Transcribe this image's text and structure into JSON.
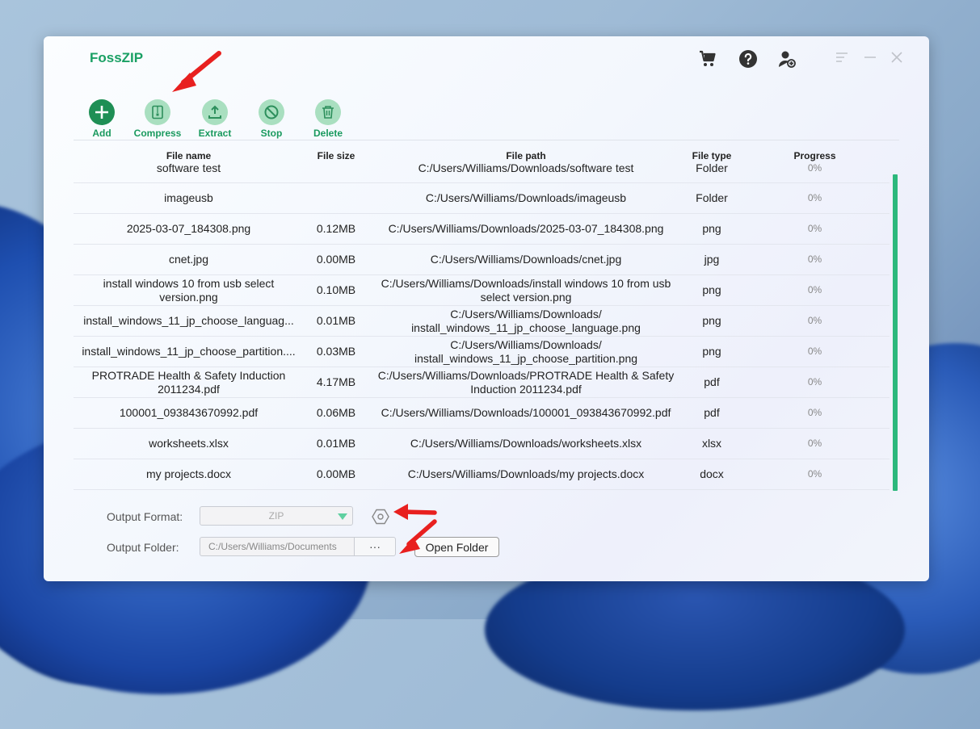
{
  "app": {
    "title": "FossZIP"
  },
  "toolbar": {
    "add": "Add",
    "compress": "Compress",
    "extract": "Extract",
    "stop": "Stop",
    "delete": "Delete"
  },
  "table": {
    "headers": [
      "File name",
      "File size",
      "File path",
      "File type",
      "Progress"
    ],
    "rows": [
      {
        "name": "software test",
        "size": "",
        "path": "C:/Users/Williams/Downloads/software test",
        "type": "Folder",
        "progress": "0%"
      },
      {
        "name": "imageusb",
        "size": "",
        "path": "C:/Users/Williams/Downloads/imageusb",
        "type": "Folder",
        "progress": "0%"
      },
      {
        "name": "2025-03-07_184308.png",
        "size": "0.12MB",
        "path": "C:/Users/Williams/Downloads/2025-03-07_184308.png",
        "type": "png",
        "progress": "0%"
      },
      {
        "name": "cnet.jpg",
        "size": "0.00MB",
        "path": "C:/Users/Williams/Downloads/cnet.jpg",
        "type": "jpg",
        "progress": "0%"
      },
      {
        "name": "install windows 10 from usb select version.png",
        "size": "0.10MB",
        "path": "C:/Users/Williams/Downloads/install windows 10 from usb select version.png",
        "type": "png",
        "progress": "0%"
      },
      {
        "name": "install_windows_11_jp_choose_languag...",
        "size": "0.01MB",
        "path": "C:/Users/Williams/Downloads/ install_windows_11_jp_choose_language.png",
        "type": "png",
        "progress": "0%"
      },
      {
        "name": "install_windows_11_jp_choose_partition....",
        "size": "0.03MB",
        "path": "C:/Users/Williams/Downloads/ install_windows_11_jp_choose_partition.png",
        "type": "png",
        "progress": "0%"
      },
      {
        "name": "PROTRADE Health & Safety Induction 2011234.pdf",
        "size": "4.17MB",
        "path": "C:/Users/Williams/Downloads/PROTRADE Health & Safety Induction 2011234.pdf",
        "type": "pdf",
        "progress": "0%"
      },
      {
        "name": "100001_093843670992.pdf",
        "size": "0.06MB",
        "path": "C:/Users/Williams/Downloads/100001_093843670992.pdf",
        "type": "pdf",
        "progress": "0%"
      },
      {
        "name": "worksheets.xlsx",
        "size": "0.01MB",
        "path": "C:/Users/Williams/Downloads/worksheets.xlsx",
        "type": "xlsx",
        "progress": "0%"
      },
      {
        "name": "my projects.docx",
        "size": "0.00MB",
        "path": "C:/Users/Williams/Downloads/my projects.docx",
        "type": "docx",
        "progress": "0%"
      }
    ]
  },
  "output": {
    "format_label": "Output Format:",
    "format_value": "ZIP",
    "folder_label": "Output Folder:",
    "folder_value": "C:/Users/Williams/Documents",
    "browse_label": "···",
    "open_folder": "Open Folder"
  },
  "colors": {
    "accent": "#1aa064",
    "scroll": "#2cb87c",
    "arrow": "#e8201f"
  }
}
